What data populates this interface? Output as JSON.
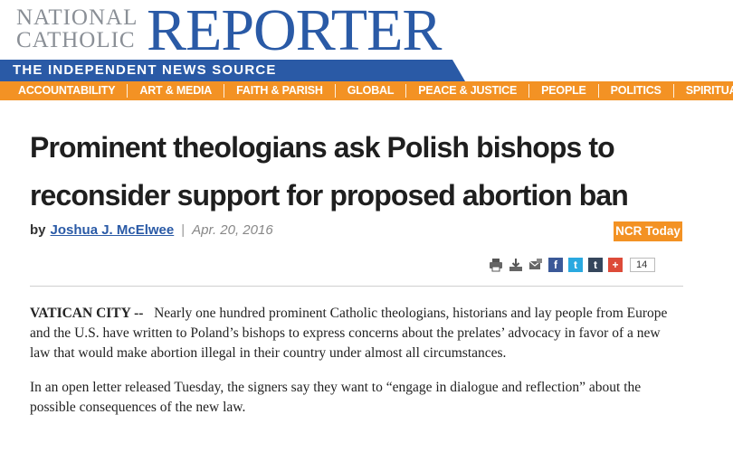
{
  "masthead": {
    "line1": "NATIONAL",
    "line2": "CATHOLIC",
    "brand": "REPORTER",
    "tagline": "THE INDEPENDENT NEWS SOURCE"
  },
  "nav": {
    "items": [
      "ACCOUNTABILITY",
      "ART & MEDIA",
      "FAITH & PARISH",
      "GLOBAL",
      "PEACE & JUSTICE",
      "PEOPLE",
      "POLITICS",
      "SPIRITUALITY"
    ]
  },
  "article": {
    "headline": "Prominent theologians ask Polish bishops to reconsider support for proposed abortion ban",
    "by_label": "by",
    "author": "Joshua J. McElwee",
    "separator": "|",
    "date": "Apr. 20, 2016",
    "section_badge": "NCR Today",
    "share_count": "14",
    "dateline": "VATICAN CITY --",
    "para1": "Nearly one hundred prominent Catholic theologians, historians and lay people from Europe and the U.S. have written to Poland’s bishops to express concerns about the prelates’ advocacy in favor of a new law that would make abortion illegal in their country under almost all circumstances.",
    "para2": "In an open letter released Tuesday, the signers say they want to “engage in dialogue and reflection” about the possible consequences of the new law."
  },
  "share_icons": [
    "print-icon",
    "save-icon",
    "email-icon",
    "facebook-icon",
    "twitter-icon",
    "tumblr-icon",
    "google-plus-icon"
  ],
  "colors": {
    "brand_blue": "#2a5aa6",
    "nav_orange": "#f39224",
    "facebook": "#3b5998",
    "twitter": "#2aa9e0",
    "tumblr": "#35465c",
    "google_plus": "#dd4b39"
  },
  "share_glyphs": {
    "facebook": "f",
    "twitter": "t",
    "tumblr": "t",
    "google_plus": "+"
  }
}
